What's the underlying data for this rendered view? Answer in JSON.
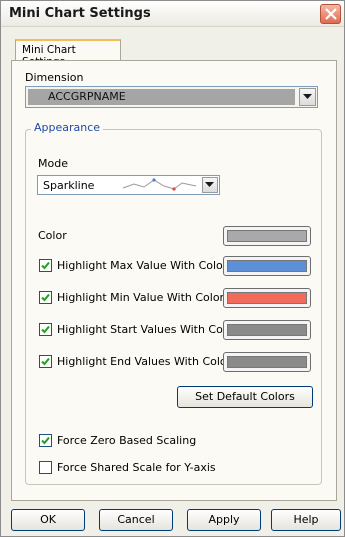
{
  "window": {
    "title": "Mini Chart Settings"
  },
  "tabs": [
    {
      "label": "Mini Chart Settings"
    }
  ],
  "dimension": {
    "label": "Dimension",
    "value": "ACCGRPNAME"
  },
  "appearance": {
    "group_label": "Appearance",
    "mode_label": "Mode",
    "mode_value": "Sparkline",
    "color_label": "Color",
    "color_value": "#a9a9a9",
    "highlights": [
      {
        "label": "Highlight Max Value With Color",
        "checked": true,
        "color": "#5b8fd6"
      },
      {
        "label": "Highlight Min Value With Color",
        "checked": true,
        "color": "#f26b5a"
      },
      {
        "label": "Highlight Start Values With Color",
        "checked": true,
        "color": "#8a8a8a"
      },
      {
        "label": "Highlight End Values With Color",
        "checked": true,
        "color": "#8a8a8a"
      }
    ],
    "set_default_label": "Set Default Colors",
    "force_zero_label": "Force Zero Based Scaling",
    "force_zero_checked": true,
    "force_shared_label": "Force Shared Scale for Y-axis",
    "force_shared_checked": false
  },
  "buttons": {
    "ok": "OK",
    "cancel": "Cancel",
    "apply": "Apply",
    "help": "Help"
  }
}
